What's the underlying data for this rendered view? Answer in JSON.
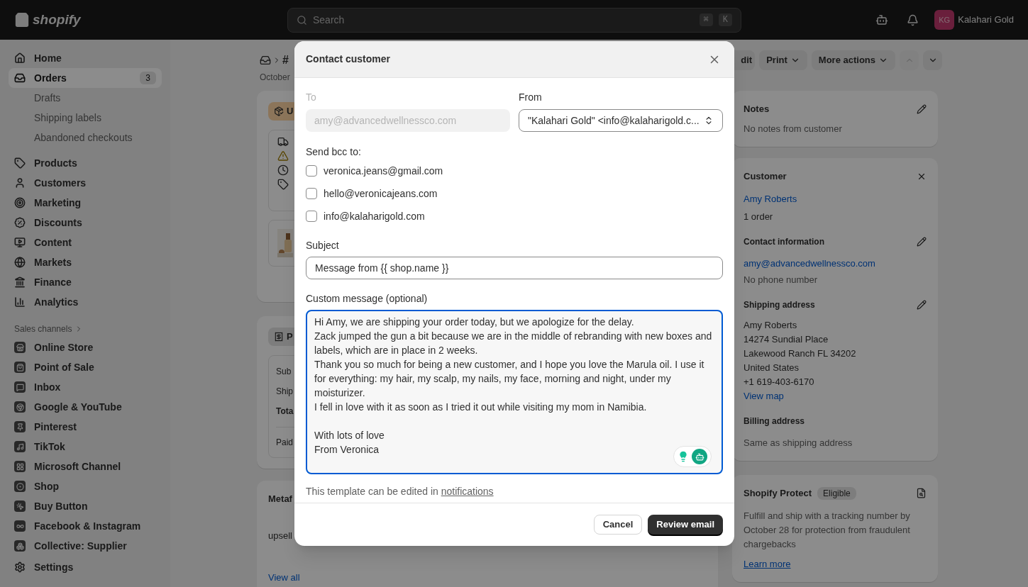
{
  "topbar": {
    "logo": "shopify",
    "search": {
      "placeholder": "Search",
      "keys": [
        "⌘",
        "K"
      ]
    },
    "store": {
      "initials": "KG",
      "name": "Kalahari Gold"
    }
  },
  "sidebar": {
    "nav": [
      {
        "label": "Home",
        "selected": false
      },
      {
        "label": "Orders",
        "selected": true,
        "badge": "3",
        "children": [
          {
            "label": "Drafts"
          },
          {
            "label": "Shipping labels"
          },
          {
            "label": "Abandoned checkouts"
          }
        ]
      },
      {
        "label": "Products",
        "selected": false
      },
      {
        "label": "Customers",
        "selected": false
      },
      {
        "label": "Marketing",
        "selected": false
      },
      {
        "label": "Discounts",
        "selected": false
      },
      {
        "label": "Content",
        "selected": false
      },
      {
        "label": "Markets",
        "selected": false
      },
      {
        "label": "Finance",
        "selected": false
      },
      {
        "label": "Analytics",
        "selected": false
      }
    ],
    "sales_channels": {
      "title": "Sales channels",
      "items": [
        {
          "label": "Online Store"
        },
        {
          "label": "Point of Sale"
        },
        {
          "label": "Inbox"
        },
        {
          "label": "Google & YouTube"
        },
        {
          "label": "Pinterest"
        },
        {
          "label": "TikTok"
        },
        {
          "label": "Microsoft Channel"
        },
        {
          "label": "Shop"
        },
        {
          "label": "Buy Button"
        },
        {
          "label": "Facebook & Instagram"
        },
        {
          "label": "Collective: Supplier"
        }
      ]
    },
    "settings": {
      "label": "Settings"
    }
  },
  "order": {
    "breadcrumb": "#",
    "date": "October",
    "actions": [
      {
        "label": "dit",
        "kind": "button"
      },
      {
        "label": "Print",
        "kind": "menu"
      },
      {
        "label": "More actions",
        "kind": "menu"
      }
    ],
    "nav_buttons": [
      {
        "kind": "up",
        "disabled": true
      },
      {
        "kind": "down",
        "disabled": false
      }
    ],
    "fulfillment": {
      "badge": "U"
    },
    "payment": {
      "badge": "P",
      "rows": [
        {
          "label": "Sub",
          "bold": false
        },
        {
          "label": "Ship",
          "bold": false
        },
        {
          "label": "Tota",
          "bold": true
        },
        {
          "label": "Paid",
          "bold": false
        }
      ]
    },
    "metafields": {
      "title": "Metaf",
      "field": "upsell",
      "link": "View all"
    }
  },
  "notes": {
    "title": "Notes",
    "text": "No notes from customer"
  },
  "customer": {
    "title": "Customer",
    "name": "Amy Roberts",
    "orders": "1 order",
    "contact": {
      "title": "Contact information",
      "email": "amy@advancedwellnessco.com",
      "phone": "No phone number"
    },
    "shipping": {
      "title": "Shipping address",
      "lines": [
        "Amy Roberts",
        "14274 Sundial Place",
        "Lakewood Ranch FL 34202",
        "United States",
        "+1 619-403-6170"
      ],
      "link": "View map"
    },
    "billing": {
      "title": "Billing address",
      "text": "Same as shipping address"
    }
  },
  "protect": {
    "title": "Shopify Protect",
    "badge": "Eligible",
    "text": "Fulfill and ship with a tracking number by October 28 for protection from fraudulent chargebacks",
    "link": "Learn more"
  },
  "modal": {
    "title": "Contact customer",
    "to": {
      "label": "To",
      "value": "amy@advancedwellnessco.com",
      "disabled": true
    },
    "from": {
      "label": "From",
      "value": "\"Kalahari Gold\" <info@kalaharigold.c..."
    },
    "bcc": {
      "label": "Send bcc to:",
      "options": [
        {
          "label": "veronica.jeans@gmail.com",
          "checked": false
        },
        {
          "label": "hello@veronicajeans.com",
          "checked": false
        },
        {
          "label": "info@kalaharigold.com",
          "checked": false
        }
      ]
    },
    "subject": {
      "label": "Subject",
      "value": "Message from {{ shop.name }}"
    },
    "message": {
      "label": "Custom message (optional)",
      "value": "Hi Amy, we are shipping your order today, but we apologize for the delay.\nZack jumped the gun a bit because we are in the middle of rebranding with new boxes and labels, which are in place in 2 weeks.\nThank you so much for being a new customer, and I hope you love the Marula oil. I use it for everything: my hair, my scalp, my nails, my face, morning and night, under my moisturizer.\nI fell in love with it as soon as I tried it out while visiting my mom in Namibia.\n\nWith lots of love\nFrom Veronica"
    },
    "hint": {
      "text": "This template can be edited in ",
      "link": "notifications"
    },
    "buttons": [
      {
        "label": "Cancel",
        "kind": "secondary"
      },
      {
        "label": "Review email",
        "kind": "primary"
      }
    ]
  }
}
